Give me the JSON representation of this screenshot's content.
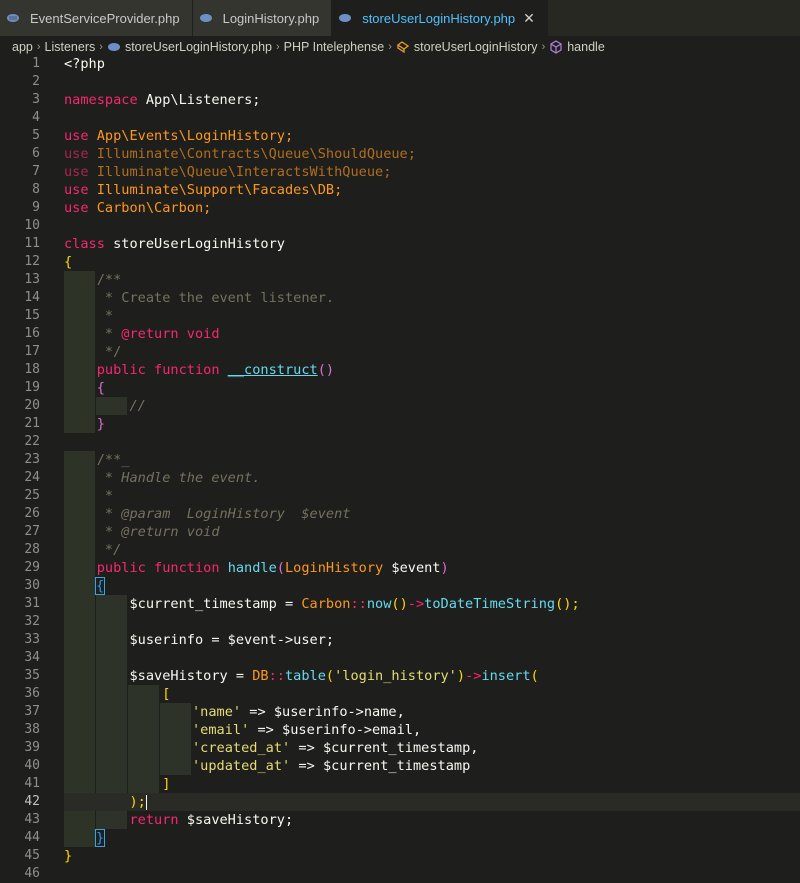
{
  "tabs": [
    {
      "label": "EventServiceProvider.php",
      "active": false
    },
    {
      "label": "LoginHistory.php",
      "active": false
    },
    {
      "label": "storeUserLoginHistory.php",
      "active": true
    }
  ],
  "breadcrumb": {
    "items": [
      "app",
      "Listeners",
      "storeUserLoginHistory.php",
      "PHP Intelephense",
      "storeUserLoginHistory",
      "handle"
    ]
  },
  "editor": {
    "line_numbers": [
      "1",
      "2",
      "3",
      "4",
      "5",
      "6",
      "7",
      "8",
      "9",
      "10",
      "11",
      "12",
      "13",
      "14",
      "15",
      "16",
      "17",
      "18",
      "19",
      "20",
      "21",
      "22",
      "23",
      "24",
      "25",
      "26",
      "27",
      "28",
      "29",
      "30",
      "31",
      "32",
      "33",
      "34",
      "35",
      "36",
      "37",
      "38",
      "39",
      "40",
      "41",
      "42",
      "43",
      "44",
      "45",
      "46"
    ],
    "code": {
      "l1": "<?php",
      "l3_kw": "namespace",
      "l3_ns": " App\\Listeners;",
      "l5_kw": "use",
      "l5_ns": " App\\Events\\LoginHistory;",
      "l6_kw": "use",
      "l6_ns": " Illuminate\\Contracts\\Queue\\ShouldQueue;",
      "l7_kw": "use",
      "l7_ns": " Illuminate\\Queue\\InteractsWithQueue;",
      "l8_kw": "use",
      "l8_ns": " Illuminate\\Support\\Facades\\DB;",
      "l9_kw": "use",
      "l9_ns": " Carbon\\Carbon;",
      "l11_kw": "class",
      "l11_name": " storeUserLoginHistory",
      "l12": "{",
      "l13": "    /**",
      "l14": "     * Create the event listener.",
      "l15": "     *",
      "l16_a": "     * ",
      "l16_b": "@return",
      "l16_c": " void",
      "l17": "     */",
      "l18_a": "    public function ",
      "l18_fn": "__construct",
      "l18_p": "()",
      "l19": "    {",
      "l20": "        //",
      "l21": "    }",
      "l23": "    /**_",
      "l24": "     * Handle the event.",
      "l25": "     *",
      "l26": "     * @param  LoginHistory  $event",
      "l27": "     * @return void",
      "l28": "     */",
      "l29_a": "    public function ",
      "l29_fn": "handle",
      "l29_p1": "(",
      "l29_ty": "LoginHistory",
      "l29_var": " $event",
      "l29_p2": ")",
      "l30": "{",
      "l31_var": "        $current_timestamp = ",
      "l31_cls": "Carbon",
      "l31_op": "::",
      "l31_m1": "now",
      "l31_p": "()",
      "l31_arrow": "->",
      "l31_m2": "toDateTimeString",
      "l31_end": "();",
      "l33": "        $userinfo = $event->user;",
      "l35_var": "        $saveHistory = ",
      "l35_cls": "DB",
      "l35_op": "::",
      "l35_m1": "table",
      "l35_po": "(",
      "l35_str": "'login_history'",
      "l35_pc": ")",
      "l35_arrow": "->",
      "l35_m2": "insert",
      "l35_p3": "(",
      "l36": "            [",
      "l37_str": "'name'",
      "l37_rest": " => $userinfo->name,",
      "l38_str": "'email'",
      "l38_rest": " => $userinfo->email,",
      "l39_str": "'created_at'",
      "l39_rest": " => $current_timestamp,",
      "l40_str": "'updated_at'",
      "l40_rest": " => $current_timestamp",
      "l41": "            ]",
      "l42": "        );",
      "l43_kw": "        return",
      "l43_rest": " $saveHistory;",
      "l44": "}",
      "l45": "}"
    }
  },
  "colors": {
    "background": "#1e1f1c",
    "keyword": "#f92672",
    "function": "#66d9ef",
    "string": "#e6db74",
    "class": "#fd971f",
    "comment": "#75715e"
  }
}
